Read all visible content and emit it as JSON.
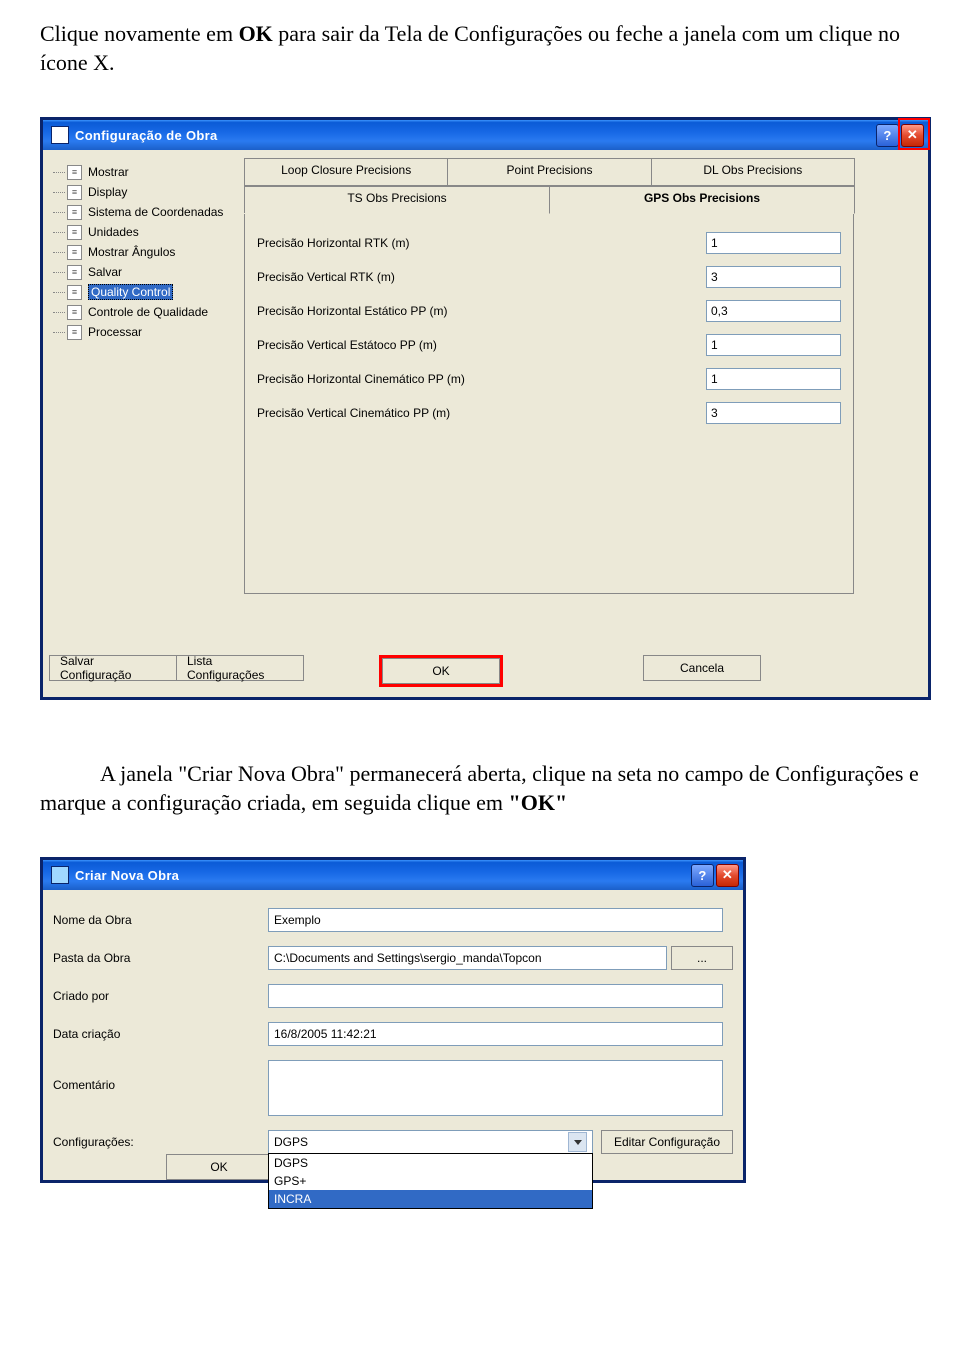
{
  "para1_a": "Clique novamente em ",
  "para1_b": "OK",
  "para1_c": " para sair da Tela de Configurações ou feche a janela com um clique no ícone X.",
  "para2_a": "A janela \"Criar Nova Obra\" permanecerá aberta, clique na seta no campo de Configurações e marque a configuração criada, em seguida clique em ",
  "para2_b": "\"OK\"",
  "config_title": "Configuração de Obra",
  "tree": [
    "Mostrar",
    "Display",
    "Sistema de Coordenadas",
    "Unidades",
    "Mostrar Ângulos",
    "Salvar",
    "Quality Control",
    "Controle de Qualidade",
    "Processar"
  ],
  "tree_selected": "Quality Control",
  "tabs_row1": [
    "Loop Closure Precisions",
    "Point Precisions",
    "DL Obs Precisions"
  ],
  "tabs_row2": [
    "TS Obs Precisions",
    "GPS Obs Precisions"
  ],
  "active_tab": "GPS Obs Precisions",
  "fields": [
    {
      "label": "Precisão Horizontal RTK (m)",
      "value": "1"
    },
    {
      "label": "Precisão Vertical RTK (m)",
      "value": "3"
    },
    {
      "label": "Precisão Horizontal Estático PP (m)",
      "value": "0,3"
    },
    {
      "label": "Precisão Vertical Estátoco PP (m)",
      "value": "1"
    },
    {
      "label": "Precisão Horizontal Cinemático PP (m)",
      "value": "1"
    },
    {
      "label": "Precisão Vertical Cinemático PP (m)",
      "value": "3"
    }
  ],
  "footer": {
    "salvar": "Salvar Configuração",
    "lista": "Lista Configurações",
    "ok": "OK",
    "cancela": "Cancela"
  },
  "new_title": "Criar Nova Obra",
  "n_nome_lbl": "Nome da Obra",
  "n_nome_v": "Exemplo",
  "n_pasta_lbl": "Pasta da Obra",
  "n_pasta_v": "C:\\Documents and Settings\\sergio_manda\\Topcon",
  "n_browse": "...",
  "n_criado_lbl": "Criado por",
  "n_criado_v": "",
  "n_data_lbl": "Data criação",
  "n_data_v": "16/8/2005 11:42:21",
  "n_coment_lbl": "Comentário",
  "n_coment_v": "",
  "n_config_lbl": "Configurações:",
  "n_config_v": "DGPS",
  "n_edit": "Editar Configuração",
  "dd": [
    "DGPS",
    "GPS+",
    "INCRA"
  ],
  "dd_sel": "INCRA",
  "ok2": "OK"
}
